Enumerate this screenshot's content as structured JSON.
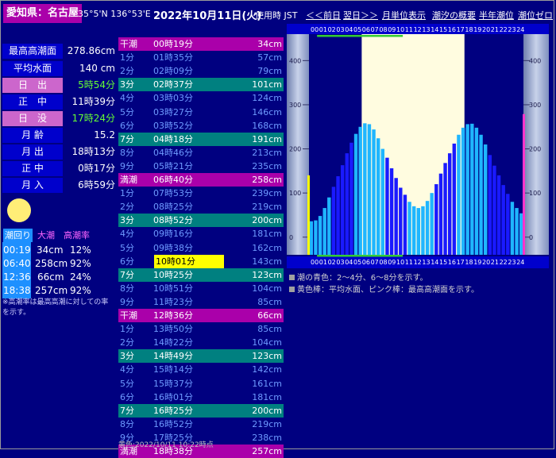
{
  "header": {
    "location": "愛知県：名古屋",
    "coords": "35°5'N 136°53'E",
    "date": "2022年10月11日(火)",
    "timezone": "使用時 JST",
    "links": [
      "＜＜前日",
      "翌日＞＞",
      "月単位表示",
      "潮汐の概要",
      "半年潮位",
      "潮位ゼロ"
    ]
  },
  "info": [
    {
      "label": "最高高潮面",
      "value": "278.86cm",
      "style": "blue"
    },
    {
      "label": "平均水面",
      "value": "140 cm",
      "style": "blue"
    },
    {
      "label": "日　出",
      "value": "5時54分",
      "style": "mag"
    },
    {
      "label": "正　中",
      "value": "11時39分",
      "style": "blue"
    },
    {
      "label": "日　没",
      "value": "17時24分",
      "style": "mag"
    },
    {
      "label": "月 齢",
      "value": "15.2",
      "style": "blue"
    },
    {
      "label": "月 出",
      "value": "18時13分",
      "style": "blue"
    },
    {
      "label": "正 中",
      "value": "0時17分",
      "style": "blue"
    },
    {
      "label": "月 入",
      "value": "6時59分",
      "style": "blue"
    }
  ],
  "schedule": {
    "headers": [
      "潮回り",
      "大潮",
      "高潮率"
    ],
    "rows": [
      {
        "time": "00:19",
        "height": "34cm",
        "pct": "12%"
      },
      {
        "time": "06:40",
        "height": "258cm",
        "pct": "92%"
      },
      {
        "time": "12:36",
        "height": "66cm",
        "pct": "24%"
      },
      {
        "time": "18:38",
        "height": "257cm",
        "pct": "92%"
      }
    ],
    "note": "※高潮率は最高高潮に対しての率を示す。"
  },
  "tide_list": [
    {
      "label": "干潮",
      "time": "00時19分",
      "cm": "34cm",
      "style": "mag"
    },
    {
      "label": "1分",
      "time": "01時35分",
      "cm": "57cm",
      "style": "plain"
    },
    {
      "label": "2分",
      "time": "02時09分",
      "cm": "79cm",
      "style": "plain"
    },
    {
      "label": "3分",
      "time": "02時37分",
      "cm": "101cm",
      "style": "teal"
    },
    {
      "label": "4分",
      "time": "03時03分",
      "cm": "124cm",
      "style": "plain"
    },
    {
      "label": "5分",
      "time": "03時27分",
      "cm": "146cm",
      "style": "plain"
    },
    {
      "label": "6分",
      "time": "03時52分",
      "cm": "168cm",
      "style": "plain"
    },
    {
      "label": "7分",
      "time": "04時18分",
      "cm": "191cm",
      "style": "teal"
    },
    {
      "label": "8分",
      "time": "04時46分",
      "cm": "213cm",
      "style": "plain"
    },
    {
      "label": "9分",
      "time": "05時21分",
      "cm": "235cm",
      "style": "plain"
    },
    {
      "label": "満潮",
      "time": "06時40分",
      "cm": "258cm",
      "style": "mag"
    },
    {
      "label": "1分",
      "time": "07時53分",
      "cm": "239cm",
      "style": "plain"
    },
    {
      "label": "2分",
      "time": "08時25分",
      "cm": "219cm",
      "style": "plain"
    },
    {
      "label": "3分",
      "time": "08時52分",
      "cm": "200cm",
      "style": "teal"
    },
    {
      "label": "4分",
      "time": "09時16分",
      "cm": "181cm",
      "style": "plain"
    },
    {
      "label": "5分",
      "time": "09時38分",
      "cm": "162cm",
      "style": "plain"
    },
    {
      "label": "6分",
      "time": "10時01分",
      "cm": "143cm",
      "style": "yel"
    },
    {
      "label": "7分",
      "time": "10時25分",
      "cm": "123cm",
      "style": "teal"
    },
    {
      "label": "8分",
      "time": "10時51分",
      "cm": "104cm",
      "style": "plain"
    },
    {
      "label": "9分",
      "time": "11時23分",
      "cm": "85cm",
      "style": "plain"
    },
    {
      "label": "干潮",
      "time": "12時36分",
      "cm": "66cm",
      "style": "mag"
    },
    {
      "label": "1分",
      "time": "13時50分",
      "cm": "85cm",
      "style": "plain"
    },
    {
      "label": "2分",
      "time": "14時22分",
      "cm": "104cm",
      "style": "plain"
    },
    {
      "label": "3分",
      "time": "14時49分",
      "cm": "123cm",
      "style": "teal"
    },
    {
      "label": "4分",
      "time": "15時14分",
      "cm": "142cm",
      "style": "plain"
    },
    {
      "label": "5分",
      "time": "15時37分",
      "cm": "161cm",
      "style": "plain"
    },
    {
      "label": "6分",
      "time": "16時01分",
      "cm": "181cm",
      "style": "plain"
    },
    {
      "label": "7分",
      "time": "16時25分",
      "cm": "200cm",
      "style": "teal"
    },
    {
      "label": "8分",
      "time": "16時52分",
      "cm": "219cm",
      "style": "plain"
    },
    {
      "label": "9分",
      "time": "17時25分",
      "cm": "238cm",
      "style": "plain"
    },
    {
      "label": "満潮",
      "time": "18時38分",
      "cm": "257cm",
      "style": "mag"
    }
  ],
  "footnote": "黄色:2022/10/11 10:22時点",
  "legend": [
    "潮の青色：2〜4分、6〜8分を示す。",
    "黄色棒：平均水面、ピンク棒：最高高潮面を示す。"
  ],
  "colors": {
    "background": "#000080",
    "bar_light": "#1fb6ff",
    "bar_dark": "#1a1aff",
    "daylight": "#fffce0",
    "magenta": "#aa00aa",
    "teal": "#008080"
  },
  "chart_data": {
    "type": "bar",
    "hour_axis_labels": [
      "00",
      "01",
      "02",
      "03",
      "04",
      "05",
      "06",
      "07",
      "08",
      "09",
      "10",
      "11",
      "12",
      "13",
      "14",
      "15",
      "16",
      "17",
      "18",
      "19",
      "20",
      "21",
      "22",
      "23",
      "24"
    ],
    "y_ticks": [
      0,
      100,
      200,
      300,
      400
    ],
    "ylim": [
      -40,
      460
    ],
    "daylight_hours": [
      5.9,
      17.4
    ],
    "mean_sea_level_cm": 140,
    "highest_high_water_cm": 278.86,
    "x_hours": [
      0,
      0.5,
      1,
      1.5,
      2,
      2.5,
      3,
      3.5,
      4,
      4.5,
      5,
      5.5,
      6,
      6.5,
      7,
      7.5,
      8,
      8.5,
      9,
      9.5,
      10,
      10.5,
      11,
      11.5,
      12,
      12.5,
      13,
      13.5,
      14,
      14.5,
      15,
      15.5,
      16,
      16.5,
      17,
      17.5,
      18,
      18.5,
      19,
      19.5,
      20,
      20.5,
      21,
      21.5,
      22,
      22.5,
      23,
      23.5
    ],
    "values": [
      36,
      38,
      48,
      66,
      90,
      114,
      138,
      163,
      190,
      214,
      234,
      250,
      258,
      256,
      244,
      224,
      200,
      180,
      156,
      134,
      112,
      96,
      80,
      70,
      66,
      70,
      82,
      100,
      120,
      144,
      168,
      190,
      212,
      232,
      248,
      256,
      257,
      248,
      232,
      210,
      186,
      162,
      140,
      118,
      98,
      80,
      66,
      54
    ],
    "dark_bar_indices": [
      5,
      6,
      7,
      8,
      9,
      17,
      18,
      19,
      20,
      21,
      28,
      29,
      30,
      31,
      32,
      40,
      41,
      42,
      43,
      44
    ]
  }
}
